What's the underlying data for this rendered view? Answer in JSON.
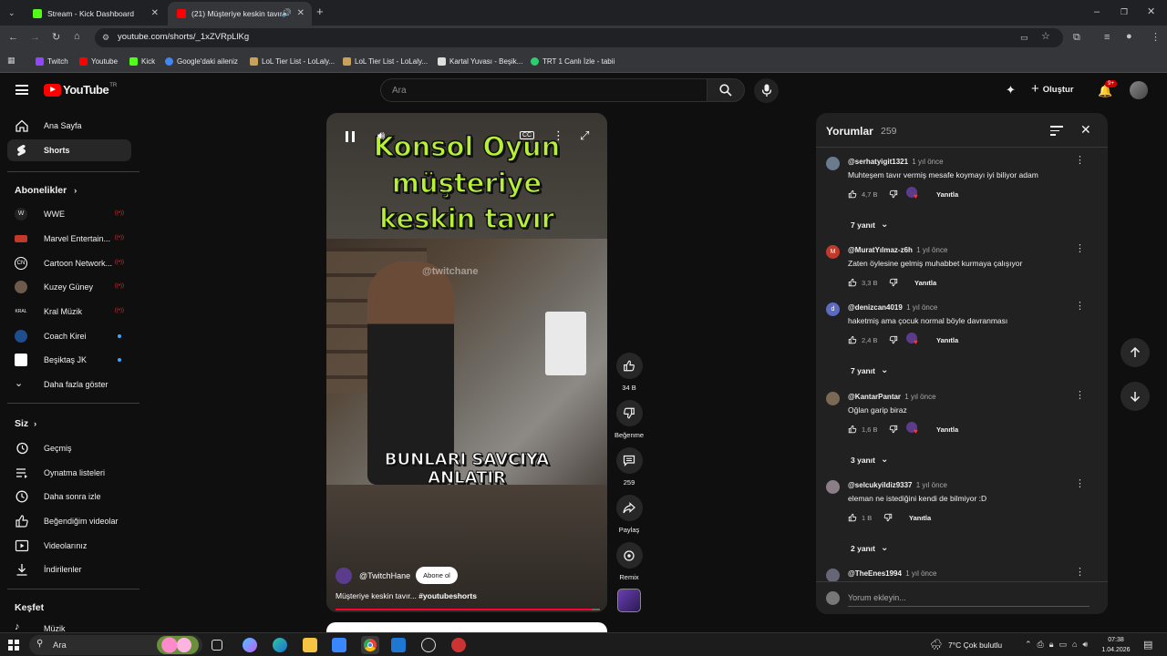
{
  "browser": {
    "tabs": [
      {
        "title": "Stream - Kick Dashboard",
        "active": false
      },
      {
        "title": "(21) Müşteriye keskin tavır",
        "active": true
      }
    ],
    "new_tab": "+",
    "url": "youtube.com/shorts/_1xZVRpLlKg",
    "bookmarks": [
      "Twitch",
      "Youtube",
      "Kick",
      "Google'daki aileniz",
      "LoL Tier List - LoLaly...",
      "LoL Tier List - LoLaly...",
      "Kartal Yuvası - Beşik...",
      "TRT 1 Canlı İzle - tabii"
    ]
  },
  "youtube": {
    "logo_text": "YouTube",
    "logo_region": "TR",
    "search_placeholder": "Ara",
    "create_label": "Oluştur",
    "notification_badge": "9+"
  },
  "sidebar": {
    "main": [
      {
        "label": "Ana Sayfa",
        "icon": "home-icon"
      },
      {
        "label": "Shorts",
        "icon": "shorts-icon",
        "active": true
      }
    ],
    "subscriptions_title": "Abonelikler",
    "subscriptions": [
      {
        "label": "WWE",
        "status": "live"
      },
      {
        "label": "Marvel Entertain...",
        "status": "live"
      },
      {
        "label": "Cartoon Network...",
        "status": "live"
      },
      {
        "label": "Kuzey Güney",
        "status": "live"
      },
      {
        "label": "Kral Müzik",
        "status": "live"
      },
      {
        "label": "Coach Kirei",
        "status": "new"
      },
      {
        "label": "Beşiktaş JK",
        "status": "new"
      }
    ],
    "show_more": "Daha fazla göster",
    "you_title": "Siz",
    "you_items": [
      {
        "label": "Geçmiş",
        "icon": "history-icon"
      },
      {
        "label": "Oynatma listeleri",
        "icon": "playlist-icon"
      },
      {
        "label": "Daha sonra izle",
        "icon": "watch-later-icon"
      },
      {
        "label": "Beğendiğim videolar",
        "icon": "like-icon"
      },
      {
        "label": "Videolarınız",
        "icon": "your-videos-icon"
      },
      {
        "label": "İndirilenler",
        "icon": "download-icon"
      }
    ],
    "explore_title": "Keşfet",
    "explore_items": [
      {
        "label": "Müzik",
        "icon": "music-icon"
      }
    ]
  },
  "video": {
    "overlay_title_line1": "Konsol Oyun",
    "overlay_title_line2": "müşteriye",
    "overlay_title_line3": "keskin tavır",
    "subtitle_line1": "BUNLARI SAVCIYA",
    "subtitle_line2": "ANLATIR",
    "watermark": "@twitchane",
    "channel": "@TwitchHane",
    "subscribe_label": "Abone ol",
    "title": "Müşteriye keskin tavır...",
    "hashtag": "#youtubeshorts",
    "progress": 0.97
  },
  "actions": {
    "likes": "34 B",
    "dislike_label": "Beğenme",
    "comments": "259",
    "share_label": "Paylaş",
    "remix_label": "Remix"
  },
  "comments": {
    "title": "Yorumlar",
    "count": "259",
    "items": [
      {
        "user": "@serhatyigit1321",
        "time": "1 yıl önce",
        "text": "Muhteşem tavır vermiş mesafe koymayı iyi biliyor adam",
        "likes": "4,7 B",
        "creator_heart": true,
        "replies": "7 yanıt",
        "avatar_color": "#6b7a8c",
        "initial": ""
      },
      {
        "user": "@MuratYılmaz-z6h",
        "time": "1 yıl önce",
        "text": "Zaten öylesine gelmiş muhabbet kurmaya çalışıyor",
        "likes": "3,3 B",
        "creator_heart": false,
        "replies": "",
        "avatar_color": "#c0392b",
        "initial": "M"
      },
      {
        "user": "@denizcan4019",
        "time": "1 yıl önce",
        "text": "haketmiş ama çocuk normal böyle davranması",
        "likes": "2,4 B",
        "creator_heart": true,
        "replies": "7 yanıt",
        "avatar_color": "#5c6bc0",
        "initial": "d"
      },
      {
        "user": "@KantarPantar",
        "time": "1 yıl önce",
        "text": "Oğlan garip biraz",
        "likes": "1,6 B",
        "creator_heart": true,
        "replies": "3 yanıt",
        "avatar_color": "#7a6a55",
        "initial": ""
      },
      {
        "user": "@selcukyildiz9337",
        "time": "1 yıl önce",
        "text": "eleman ne istediğini kendi de bilmiyor :D",
        "likes": "1 B",
        "creator_heart": false,
        "replies": "2 yanıt",
        "avatar_color": "#8a7f86",
        "initial": ""
      },
      {
        "user": "@TheEnes1994",
        "time": "1 yıl önce",
        "text": "",
        "likes": "",
        "creator_heart": false,
        "replies": "",
        "avatar_color": "#667",
        "initial": ""
      }
    ],
    "reply_label": "Yanıtla",
    "add_placeholder": "Yorum ekleyin..."
  },
  "taskbar": {
    "search": "Ara",
    "weather": "7°C  Çok bulutlu",
    "time": "07:38",
    "date": "1.04.2026"
  },
  "colors": {
    "youtube_red": "#ff0000",
    "kick_green": "#53fc18",
    "live_red": "#cc3333",
    "new_blue": "#3ea6ff"
  }
}
